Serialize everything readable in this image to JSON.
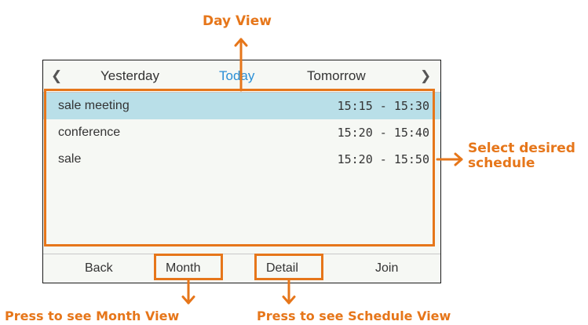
{
  "annotations": {
    "day_view": "Day View",
    "select_line1": "Select desired",
    "select_line2": "schedule",
    "month_view": "Press to see Month View",
    "schedule_view": "Press to see Schedule View",
    "accent_color": "#e6761a"
  },
  "nav": {
    "prev_icon": "chevron-left-icon",
    "prev_label": "Yesterday",
    "current_label": "Today",
    "next_label": "Tomorrow",
    "next_icon": "chevron-right-icon",
    "current_color": "#2a8fd6"
  },
  "schedules": [
    {
      "title": "sale meeting",
      "time": "15:15 - 15:30",
      "selected": true
    },
    {
      "title": "conference",
      "time": "15:20 - 15:40",
      "selected": false
    },
    {
      "title": "sale",
      "time": "15:20 - 15:50",
      "selected": false
    }
  ],
  "softkeys": {
    "back": "Back",
    "month": "Month",
    "detail": "Detail",
    "join": "Join"
  }
}
